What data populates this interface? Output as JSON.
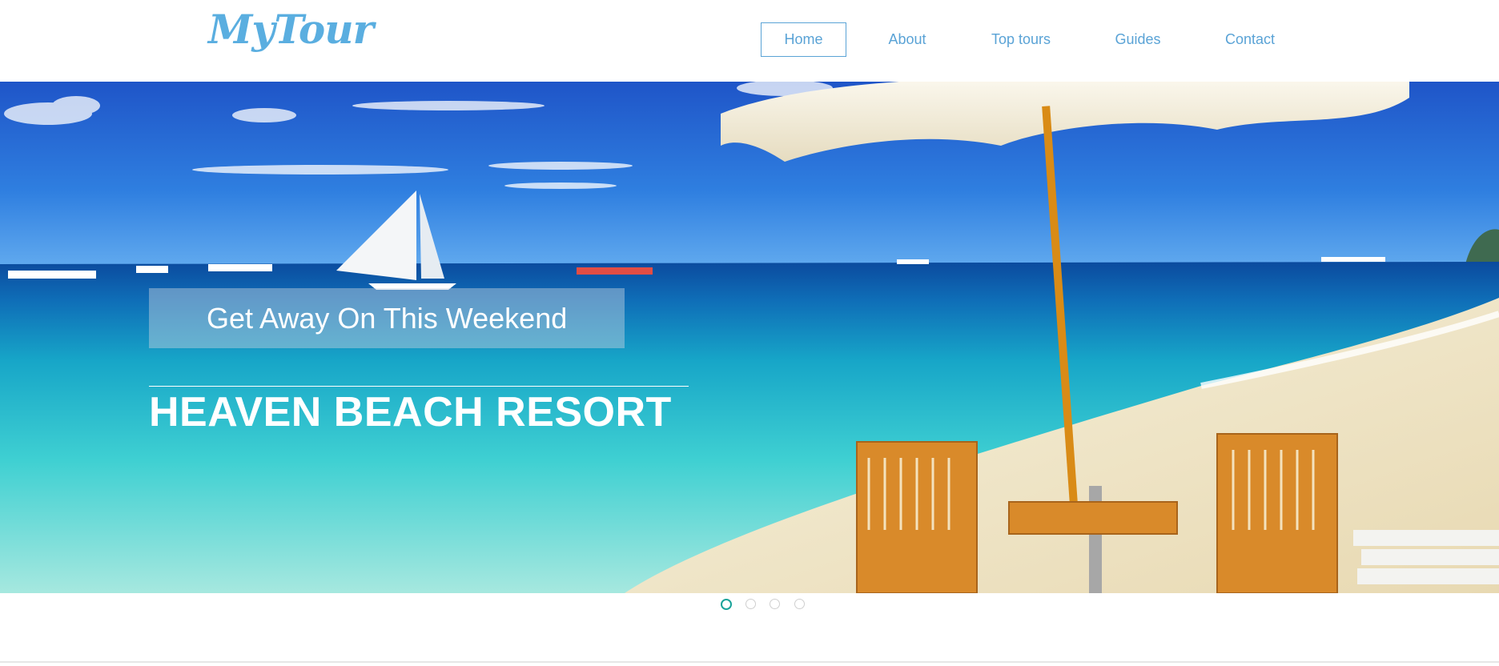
{
  "header": {
    "logo_text": "MyTour",
    "nav": [
      {
        "label": "Home",
        "active": true
      },
      {
        "label": "About",
        "active": false
      },
      {
        "label": "Top tours",
        "active": false
      },
      {
        "label": "Guides",
        "active": false
      },
      {
        "label": "Contact",
        "active": false
      }
    ]
  },
  "hero": {
    "tagline": "Get Away On This Weekend",
    "headline": "HEAVEN BEACH RESORT",
    "image_description_icon": "beach-photo"
  },
  "slider": {
    "dot_count": 4,
    "active_index": 0
  },
  "colors": {
    "brand": "#5aaee0",
    "nav_text": "#5aa3d6",
    "active_dot": "#1aa39a"
  }
}
